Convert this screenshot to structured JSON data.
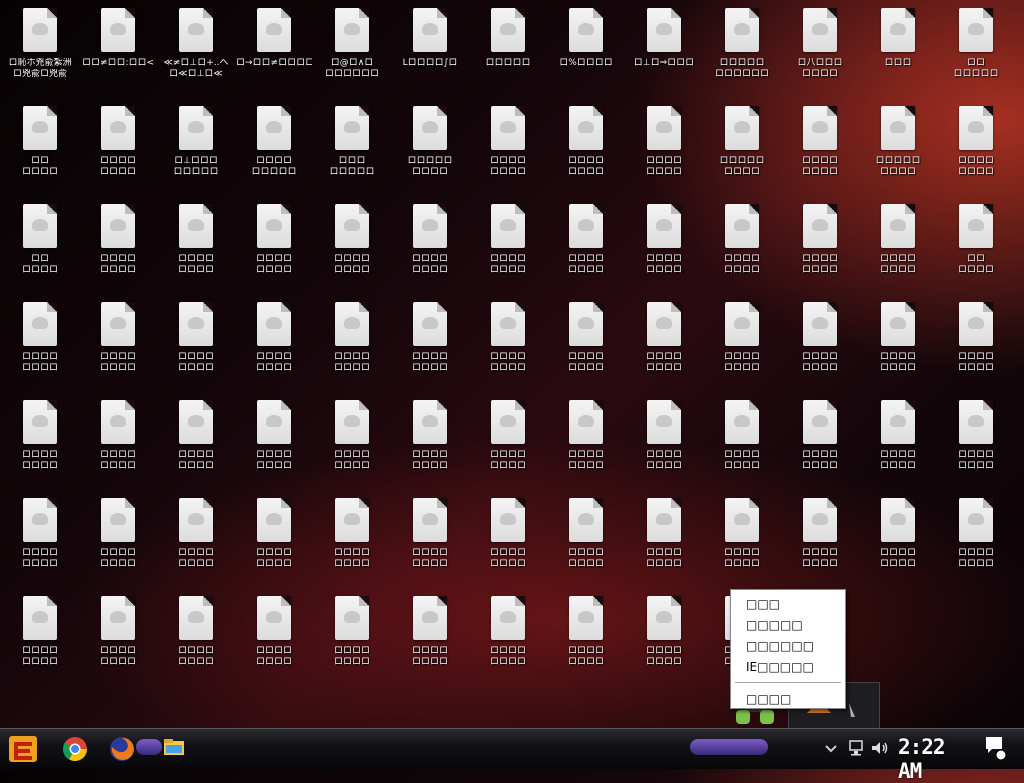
{
  "desktop": {
    "icons": [
      {
        "l1": "ロ恥ホ兇兪紮洲",
        "l2": "ロ兇兪ロ兇兪"
      },
      {
        "l1": "ロロ≠ロロ:ロロ<",
        "l2": ""
      },
      {
        "l1": "≪≠ロ⊥ロ+..ヘ",
        "l2": "ロ≪ロ⊥ロ≪"
      },
      {
        "l1": "ロ→ロロ≠ロロロロロ",
        "l2": ""
      },
      {
        "l1": "ロ@ロ∧ロ",
        "l2": "ロロロロロロ"
      },
      {
        "l1": "Lロロロロ∫ロ",
        "l2": ""
      },
      {
        "l1": "ロロロロロ",
        "l2": ""
      },
      {
        "l1": "ロ%ロロロロ",
        "l2": ""
      },
      {
        "l1": "ロ⊥ロ⇒ロロロ",
        "l2": ""
      },
      {
        "l1": "ロロロロロ",
        "l2": "ロロロロロロ"
      },
      {
        "l1": "ロ八ロロロ",
        "l2": "ロロロロ"
      },
      {
        "l1": "ロロロ",
        "l2": ""
      },
      {
        "l1": "ロロ",
        "l2": "ロロロロロ"
      },
      {
        "l1": "ロロ",
        "l2": "ロロロロ"
      },
      {
        "l1": "ロロロロ",
        "l2": "ロロロロ"
      },
      {
        "l1": "ロ⊥ロロロ",
        "l2": "ロロロロロ"
      },
      {
        "l1": "ロロロロ",
        "l2": "ロロロロロ"
      },
      {
        "l1": "ロロロ",
        "l2": "ロロロロロ"
      },
      {
        "l1": "ロロロロロ",
        "l2": "ロロロロ"
      },
      {
        "l1": "ロロロロ",
        "l2": "ロロロロ"
      },
      {
        "l1": "ロロロロ",
        "l2": "ロロロロ"
      },
      {
        "l1": "ロロロロ",
        "l2": "ロロロロ"
      },
      {
        "l1": "ロロロロロ",
        "l2": "ロロロロ"
      },
      {
        "l1": "ロロロロ",
        "l2": "ロロロロ"
      },
      {
        "l1": "ロロロロロ",
        "l2": "ロロロロ"
      },
      {
        "l1": "ロロロロ",
        "l2": "ロロロロ"
      },
      {
        "l1": "ロロ",
        "l2": "ロロロロ"
      },
      {
        "l1": "ロロロロ",
        "l2": "ロロロロ"
      },
      {
        "l1": "ロロロロ",
        "l2": "ロロロロ"
      },
      {
        "l1": "ロロロロ",
        "l2": "ロロロロ"
      },
      {
        "l1": "ロロロロ",
        "l2": "ロロロロ"
      },
      {
        "l1": "ロロロロ",
        "l2": "ロロロロ"
      },
      {
        "l1": "ロロロロ",
        "l2": "ロロロロ"
      },
      {
        "l1": "ロロロロ",
        "l2": "ロロロロ"
      },
      {
        "l1": "ロロロロ",
        "l2": "ロロロロ"
      },
      {
        "l1": "ロロロロ",
        "l2": "ロロロロ"
      },
      {
        "l1": "ロロロロ",
        "l2": "ロロロロ"
      },
      {
        "l1": "ロロロロ",
        "l2": "ロロロロ"
      },
      {
        "l1": "ロロ",
        "l2": "ロロロロ"
      },
      {
        "l1": "ロロロロ",
        "l2": "ロロロロ"
      },
      {
        "l1": "ロロロロ",
        "l2": "ロロロロ"
      },
      {
        "l1": "ロロロロ",
        "l2": "ロロロロ"
      },
      {
        "l1": "ロロロロ",
        "l2": "ロロロロ"
      },
      {
        "l1": "ロロロロ",
        "l2": "ロロロロ"
      },
      {
        "l1": "ロロロロ",
        "l2": "ロロロロ"
      },
      {
        "l1": "ロロロロ",
        "l2": "ロロロロ"
      },
      {
        "l1": "ロロロロ",
        "l2": "ロロロロ"
      },
      {
        "l1": "ロロロロ",
        "l2": "ロロロロ"
      },
      {
        "l1": "ロロロロ",
        "l2": "ロロロロ"
      },
      {
        "l1": "ロロロロ",
        "l2": "ロロロロ"
      },
      {
        "l1": "ロロロロ",
        "l2": "ロロロロ"
      },
      {
        "l1": "ロロロロ",
        "l2": "ロロロロ"
      },
      {
        "l1": "ロロロロ",
        "l2": "ロロロロ"
      },
      {
        "l1": "ロロロロ",
        "l2": "ロロロロ"
      },
      {
        "l1": "ロロロロ",
        "l2": "ロロロロ"
      },
      {
        "l1": "ロロロロ",
        "l2": "ロロロロ"
      },
      {
        "l1": "ロロロロ",
        "l2": "ロロロロ"
      },
      {
        "l1": "ロロロロ",
        "l2": "ロロロロ"
      },
      {
        "l1": "ロロロロ",
        "l2": "ロロロロ"
      },
      {
        "l1": "ロロロロ",
        "l2": "ロロロロ"
      },
      {
        "l1": "ロロロロ",
        "l2": "ロロロロ"
      },
      {
        "l1": "ロロロロ",
        "l2": "ロロロロ"
      },
      {
        "l1": "ロロロロ",
        "l2": "ロロロロ"
      },
      {
        "l1": "ロロロロ",
        "l2": "ロロロロ"
      },
      {
        "l1": "ロロロロ",
        "l2": "ロロロロ"
      },
      {
        "l1": "ロロロロ",
        "l2": "ロロロロ"
      },
      {
        "l1": "ロロロロ",
        "l2": "ロロロロ"
      },
      {
        "l1": "ロロロロ",
        "l2": "ロロロロ"
      },
      {
        "l1": "ロロロロ",
        "l2": "ロロロロ"
      },
      {
        "l1": "ロロロロ",
        "l2": "ロロロロ"
      },
      {
        "l1": "ロロロロ",
        "l2": "ロロロロ"
      },
      {
        "l1": "ロロロロ",
        "l2": "ロロロロ"
      },
      {
        "l1": "ロロロロ",
        "l2": "ロロロロ"
      },
      {
        "l1": "ロロロロ",
        "l2": "ロロロロ"
      },
      {
        "l1": "ロロロロ",
        "l2": "ロロロロ"
      },
      {
        "l1": "ロロロロ",
        "l2": "ロロロロ"
      },
      {
        "l1": "ロロロロ",
        "l2": "ロロロロ"
      },
      {
        "l1": "ロロロロ",
        "l2": "ロロロロ"
      },
      {
        "l1": "ロロロロ",
        "l2": "ロロロロ"
      },
      {
        "l1": "ロロロロ",
        "l2": "ロロロロ"
      },
      {
        "l1": "ロロロロ",
        "l2": "ロロロロ"
      },
      {
        "l1": "ロロロロ",
        "l2": "ロロロロ"
      },
      {
        "l1": "ロロロロ",
        "l2": "ロロロロ"
      },
      {
        "l1": "ロロロロ",
        "l2": "ロロロロ"
      },
      {
        "l1": "ロロロロ",
        "l2": "ロロロロ"
      },
      {
        "l1": "ロロロロ",
        "l2": "ロロロロ"
      },
      {
        "l1": "ロロロロ",
        "l2": "ロロロロ"
      },
      {
        "l1": "ロロロロ",
        "l2": "ロロロロ"
      }
    ]
  },
  "context_menu": {
    "items": [
      "□□□",
      "□□□□□",
      "□□□□□□",
      "IE□□□□□"
    ],
    "last_item": "□□□□"
  },
  "taskbar": {
    "clock": "2:22 AM"
  },
  "colors": {
    "band": "#6a4fc0"
  }
}
